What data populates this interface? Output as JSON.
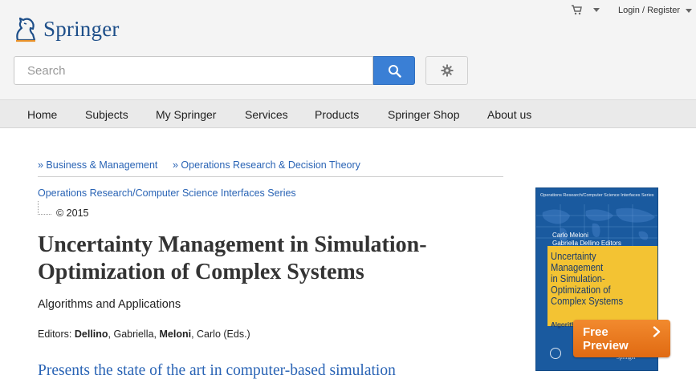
{
  "header": {
    "brand": "Springer",
    "login_label": "Login / Register",
    "search_placeholder": "Search",
    "icons": {
      "logo": "springer-horse-icon",
      "cart": "shopping-cart-icon",
      "search": "search-icon",
      "settings": "gear-icon"
    }
  },
  "nav": {
    "items": [
      "Home",
      "Subjects",
      "My Springer",
      "Services",
      "Products",
      "Springer Shop",
      "About us"
    ]
  },
  "breadcrumbs": [
    "» Business & Management",
    "» Operations Research & Decision Theory"
  ],
  "book": {
    "series": "Operations Research/Computer Science Interfaces Series",
    "copyright": "© 2015",
    "title": "Uncertainty Management in Simulation-Optimization of Complex Systems",
    "subtitle": "Algorithms and Applications",
    "editors_label": "Editors:",
    "editor1_last": "Dellino",
    "editor1_first": ", Gabriella,",
    "editor2_last": "Meloni",
    "editor2_first": ", Carlo (Eds.)",
    "tagline": "Presents the state of the art in computer-based simulation"
  },
  "cover": {
    "series_line": "Operations Research/Computer Science Interfaces Series",
    "editor_line1": "Carlo Meloni",
    "editor_line2": "Gabriella Dellino Editors",
    "title_lines": [
      "Uncertainty",
      "Management",
      "in Simulation-",
      "Optimization of",
      "Complex Systems"
    ],
    "subtitle": "Algorithms",
    "publisher": "Springer"
  },
  "preview_button": {
    "line1": "Free",
    "line2": "Preview"
  },
  "colors": {
    "brand_blue": "#1d4e89",
    "link_blue": "#2a64b5",
    "search_button": "#3a7fd5",
    "preview_orange": "#e87a1e",
    "cover_blue": "#1a5a9f",
    "cover_yellow": "#f3c333"
  }
}
